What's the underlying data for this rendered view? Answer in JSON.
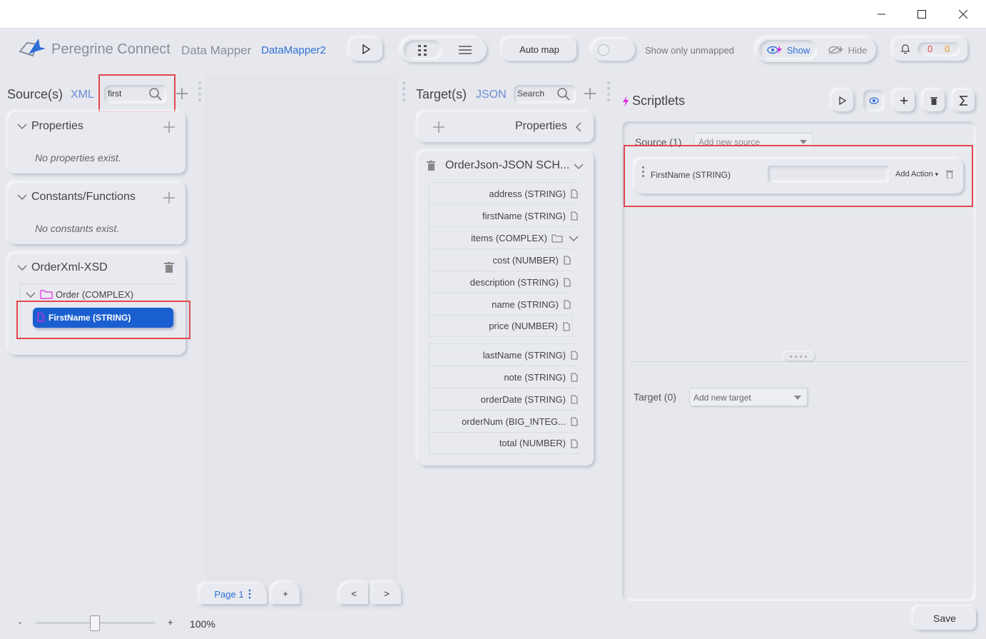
{
  "window": {
    "minimize_icon": "minimize-icon",
    "maximize_icon": "maximize-icon",
    "close_icon": "close-icon"
  },
  "header": {
    "brand": "Peregrine Connect",
    "product": "Data Mapper",
    "map_name": "DataMapper2",
    "auto_map_label": "Auto map",
    "show_only_unmapped_label": "Show only unmapped",
    "show_label": "Show",
    "hide_label": "Hide",
    "error_count": "0",
    "warning_count": "0"
  },
  "source": {
    "title": "Source(s)",
    "format": "XML",
    "search_value": "first",
    "properties": {
      "title": "Properties",
      "empty_text": "No properties exist."
    },
    "constants": {
      "title": "Constants/Functions",
      "empty_text": "No constants exist."
    },
    "schema": {
      "title": "OrderXml-XSD",
      "root": "Order (COMPLEX)",
      "selected_field": "FirstName (STRING)"
    }
  },
  "canvas": {
    "page_label": "Page 1",
    "add_page_label": "+",
    "prev_label": "<",
    "next_label": ">"
  },
  "target": {
    "title": "Target(s)",
    "format": "JSON",
    "search_placeholder": "Search",
    "properties_title": "Properties",
    "schema_title": "OrderJson-JSON SCH...",
    "fields": [
      "address (STRING)",
      "firstName (STRING)",
      "items (COMPLEX)",
      "cost (NUMBER)",
      "description (STRING)",
      "name (STRING)",
      "price (NUMBER)",
      "lastName (STRING)",
      "note (STRING)",
      "orderDate (STRING)",
      "orderNum (BIG_INTEG...",
      "total (NUMBER)"
    ]
  },
  "scriptlets": {
    "title": "Scriptlets",
    "source_label": "Source (1)",
    "add_source_placeholder": "Add new source",
    "source_field": "FirstName (STRING)",
    "add_action_label": "Add Action",
    "target_label": "Target (0)",
    "add_target_placeholder": "Add new target"
  },
  "footer": {
    "zoom_minus": "-",
    "zoom_plus": "+",
    "zoom_value": "100%",
    "zoom_level": 0.5,
    "save_label": "Save"
  },
  "colors": {
    "accent_blue": "#2f6fd6",
    "selected_field": "#1a5fd0",
    "highlight_red": "#e0484e",
    "error_red": "#e0484e",
    "warning_orange": "#e8941c"
  }
}
